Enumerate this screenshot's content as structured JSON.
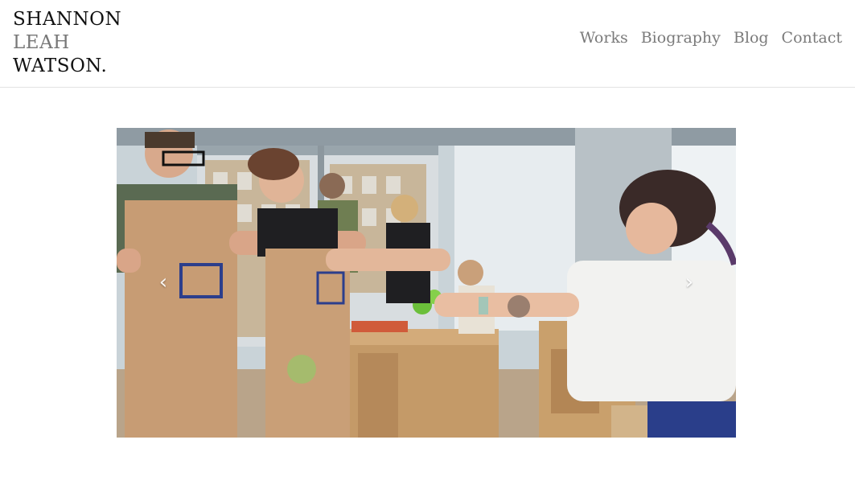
{
  "logo": {
    "line1": "SHANNON",
    "line2": "LEAH",
    "line3": "WATSON."
  },
  "nav": {
    "items": [
      "Works",
      "Biography",
      "Blog",
      "Contact"
    ]
  },
  "slider": {
    "prev_icon": "chevron-left-icon",
    "next_icon": "chevron-right-icon",
    "prev_glyph": "‹",
    "next_glyph": "›"
  },
  "colors": {
    "nav_text": "#7a7a7a",
    "logo_dark": "#111111",
    "logo_light": "#777777",
    "divider": "#e3e3e3"
  }
}
